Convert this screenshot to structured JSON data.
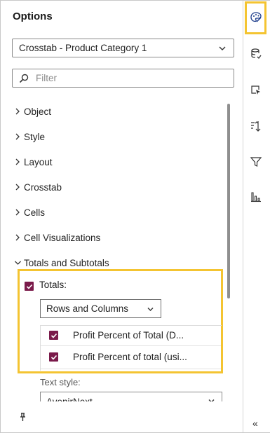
{
  "panel": {
    "title": "Options",
    "object_select": {
      "value": "Crosstab - Product Category 1"
    },
    "filter": {
      "placeholder": "Filter"
    },
    "sections": [
      {
        "label": "Object",
        "expanded": false
      },
      {
        "label": "Style",
        "expanded": false
      },
      {
        "label": "Layout",
        "expanded": false
      },
      {
        "label": "Crosstab",
        "expanded": false
      },
      {
        "label": "Cells",
        "expanded": false
      },
      {
        "label": "Cell Visualizations",
        "expanded": false
      },
      {
        "label": "Totals and Subtotals",
        "expanded": true
      }
    ],
    "totals": {
      "label": "Totals:",
      "checked": true,
      "placement_select": {
        "value": "Rows and Columns"
      },
      "items": [
        {
          "label": "Profit Percent of Total (D...",
          "checked": true
        },
        {
          "label": "Profit Percent of total (usi...",
          "checked": true
        }
      ]
    },
    "text_style": {
      "label": "Text style:",
      "value": "AvenirNext"
    }
  },
  "rail": {
    "icons": [
      "palette-icon",
      "data-source-icon",
      "selection-icon",
      "sort-icon",
      "filter-icon",
      "bar-chart-icon"
    ],
    "active": "palette-icon",
    "collapse_glyph": "«"
  },
  "colors": {
    "highlight": "#f4c431",
    "checkbox": "#7a1a4a",
    "border": "#8a8a8a"
  }
}
